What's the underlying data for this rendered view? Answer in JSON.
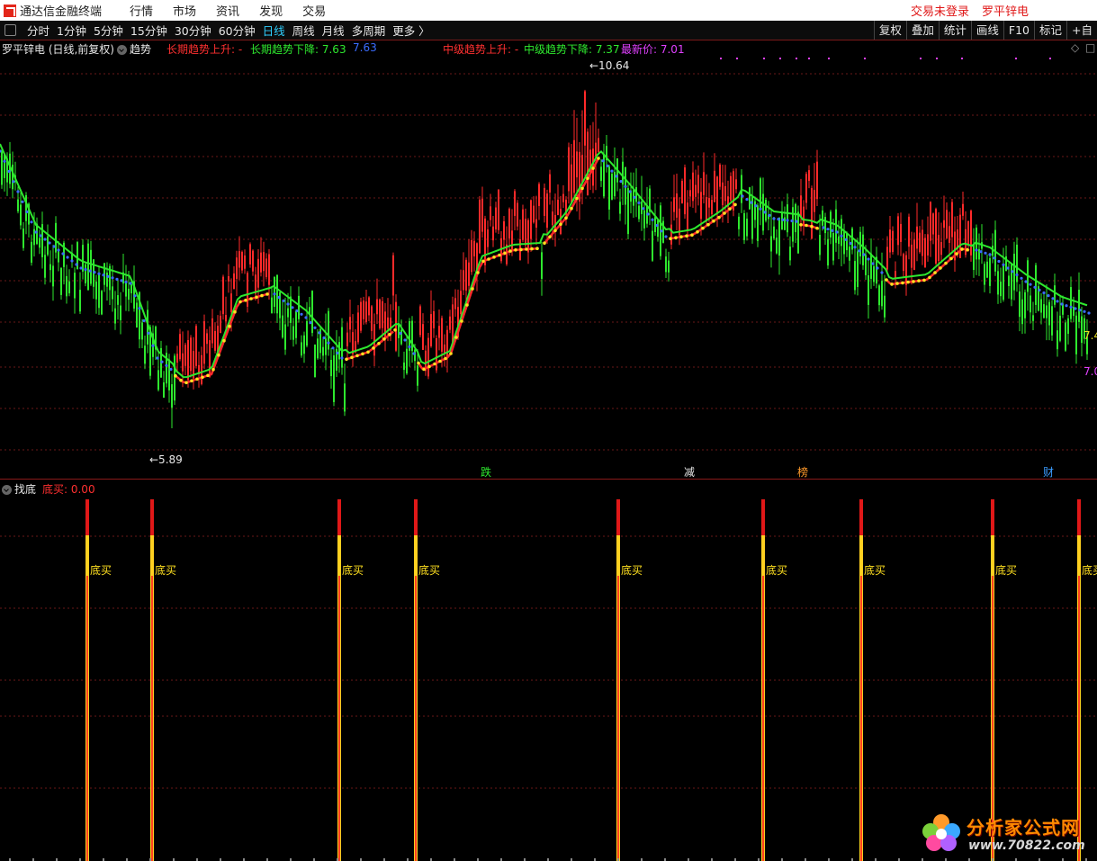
{
  "titlebar": {
    "app_title": "通达信金融终端",
    "menu": [
      "行情",
      "市场",
      "资讯",
      "发现",
      "交易"
    ],
    "login_status": "交易未登录",
    "stock_name": "罗平锌电"
  },
  "toolbar": {
    "periods": [
      "分时",
      "1分钟",
      "5分钟",
      "15分钟",
      "30分钟",
      "60分钟",
      "日线",
      "周线",
      "月线",
      "多周期",
      "更多 〉"
    ],
    "active_period": "日线",
    "right_buttons": [
      "复权",
      "叠加",
      "统计",
      "画线",
      "F10",
      "标记",
      "+自"
    ]
  },
  "main_panel": {
    "stock_label": "罗平锌电 (日线,前复权)",
    "indicator_name": "趋势",
    "long_up_label": "长期趋势上升: -",
    "long_down_label": "长期趋势下降: 7.63",
    "long_down_blue": "7.63",
    "mid_up_label": "中级趋势上升: -",
    "mid_down_label": "中级趋势下降: 7.37",
    "latest_price_label": "最新价: 7.01",
    "high_marker": "10.64",
    "low_marker": "5.89",
    "right_label_1": "7.4",
    "right_label_2": "7.0",
    "event_markers": [
      "跌",
      "减",
      "榜",
      "财"
    ]
  },
  "sub_panel": {
    "indicator_name": "找底",
    "value_label": "底买: 0.00",
    "signal_label": "底买",
    "signal_count": 10
  },
  "watermark": {
    "title": "分析家公式网",
    "url": "www.70822.com"
  },
  "colors": {
    "bull": "#ff2a2a",
    "bear": "#2ee82e",
    "blue_dots": "#3a6cff",
    "yellow_dots": "#ffe020",
    "magenta": "#e040ff",
    "grid": "#6a1818"
  },
  "chart_data": {
    "type": "candlestick",
    "price_high": 10.64,
    "price_low": 5.89,
    "latest_price": 7.01,
    "long_trend_down": 7.63,
    "mid_trend_down": 7.37,
    "sub_indicator": {
      "name": "找底",
      "series": "底买",
      "current_value": 0.0,
      "signals": 10
    }
  }
}
